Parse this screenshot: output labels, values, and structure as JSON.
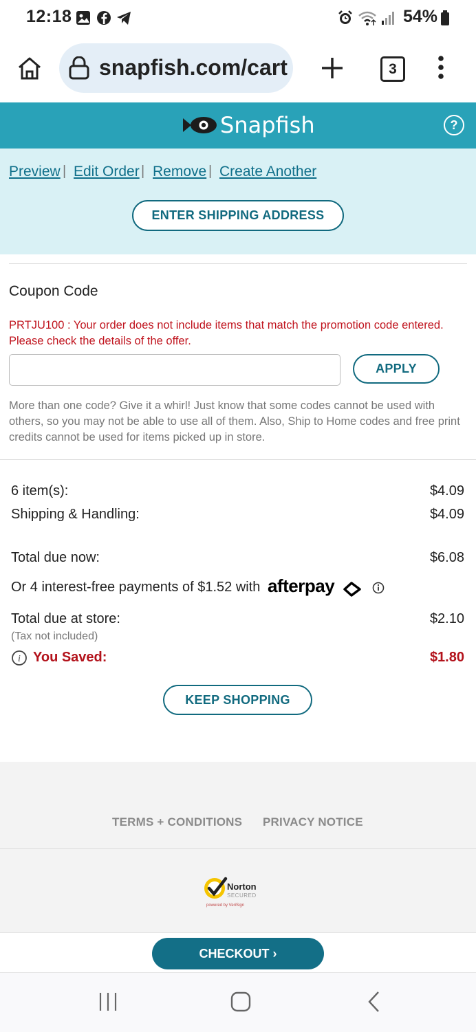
{
  "status_bar": {
    "time": "12:18",
    "battery": "54%",
    "icons": [
      "gallery-icon",
      "facebook-icon",
      "telegram-icon",
      "alarm-icon",
      "wifi-icon",
      "signal-icon",
      "battery-icon"
    ]
  },
  "browser": {
    "url": "snapfish.com/cart",
    "tab_count": "3",
    "icons": [
      "home-icon",
      "lock-icon",
      "new-tab-icon",
      "menu-icon"
    ]
  },
  "header": {
    "brand": "Snapfish",
    "help": "?",
    "color": "#29a2b8"
  },
  "order_actions": {
    "preview": "Preview",
    "edit_order": "Edit Order",
    "remove": "Remove",
    "create_another": "Create Another",
    "separator": "|",
    "enter_shipping": "ENTER SHIPPING ADDRESS"
  },
  "coupon": {
    "title": "Coupon Code",
    "error": "PRTJU100 : Your order does not include items that match the promotion code entered. Please check the details of the offer.",
    "input_value": "",
    "apply": "APPLY",
    "help": "More than one code? Give it a whirl! Just know that some codes cannot be used with others, so you may not be able to use all of them. Also, Ship to Home codes and free print credits cannot be used for items picked up in store."
  },
  "summary": {
    "items_label": "6 item(s):",
    "items_value": "$4.09",
    "shipping_label": "Shipping & Handling:",
    "shipping_value": "$4.09",
    "total_now_label": "Total due now:",
    "total_now_value": "$6.08",
    "installments": "Or 4 interest-free payments of $1.52 with",
    "afterpay": "afterpay",
    "total_store_label": "Total due at store:",
    "total_store_value": "$2.10",
    "tax_note": "(Tax not included)",
    "saved_label": "You Saved:",
    "saved_value": "$1.80",
    "keep_shopping": "KEEP SHOPPING"
  },
  "footer": {
    "terms": "TERMS + CONDITIONS",
    "privacy": "PRIVACY NOTICE",
    "norton": "Norton",
    "norton_sub": "SECURED",
    "verisign": "powered by VeriSign"
  },
  "checkout": {
    "label": "CHECKOUT ›",
    "color": "#136f87"
  }
}
